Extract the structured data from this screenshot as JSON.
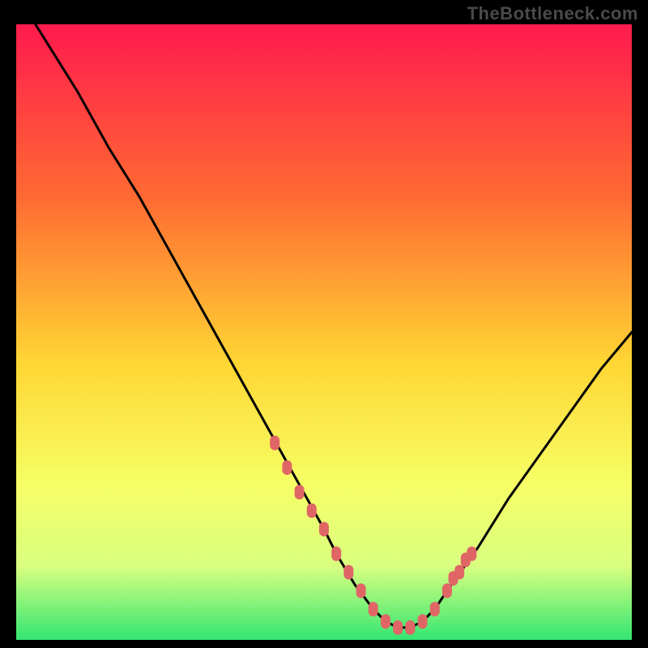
{
  "watermark": "TheBottleneck.com",
  "colors": {
    "background": "#000000",
    "gradient_top": "#ff1a4d",
    "gradient_mid_upper": "#ff6a33",
    "gradient_mid": "#ffd633",
    "gradient_mid_lower": "#f6ff66",
    "gradient_lower": "#d9ff80",
    "gradient_bottom": "#33e673",
    "curve": "#000000",
    "marker": "#e06666"
  },
  "chart_data": {
    "type": "line",
    "title": "",
    "xlabel": "",
    "ylabel": "",
    "xlim": [
      0,
      100
    ],
    "ylim": [
      0,
      100
    ],
    "series": [
      {
        "name": "bottleneck-curve",
        "x": [
          0,
          5,
          10,
          15,
          20,
          25,
          30,
          35,
          40,
          45,
          50,
          52,
          55,
          58,
          60,
          62,
          64,
          66,
          68,
          70,
          75,
          80,
          85,
          90,
          95,
          100
        ],
        "values": [
          105,
          97,
          89,
          80,
          72,
          63,
          54,
          45,
          36,
          27,
          18,
          14,
          9,
          5,
          3,
          2,
          2,
          3,
          5,
          8,
          15,
          23,
          30,
          37,
          44,
          50
        ]
      },
      {
        "name": "highlighted-points",
        "x": [
          42,
          44,
          46,
          48,
          50,
          52,
          54,
          56,
          58,
          60,
          62,
          64,
          66,
          68,
          70,
          71,
          72,
          73,
          74
        ],
        "values": [
          32,
          28,
          24,
          21,
          18,
          14,
          11,
          8,
          5,
          3,
          2,
          2,
          3,
          5,
          8,
          10,
          11,
          13,
          14
        ]
      }
    ]
  }
}
